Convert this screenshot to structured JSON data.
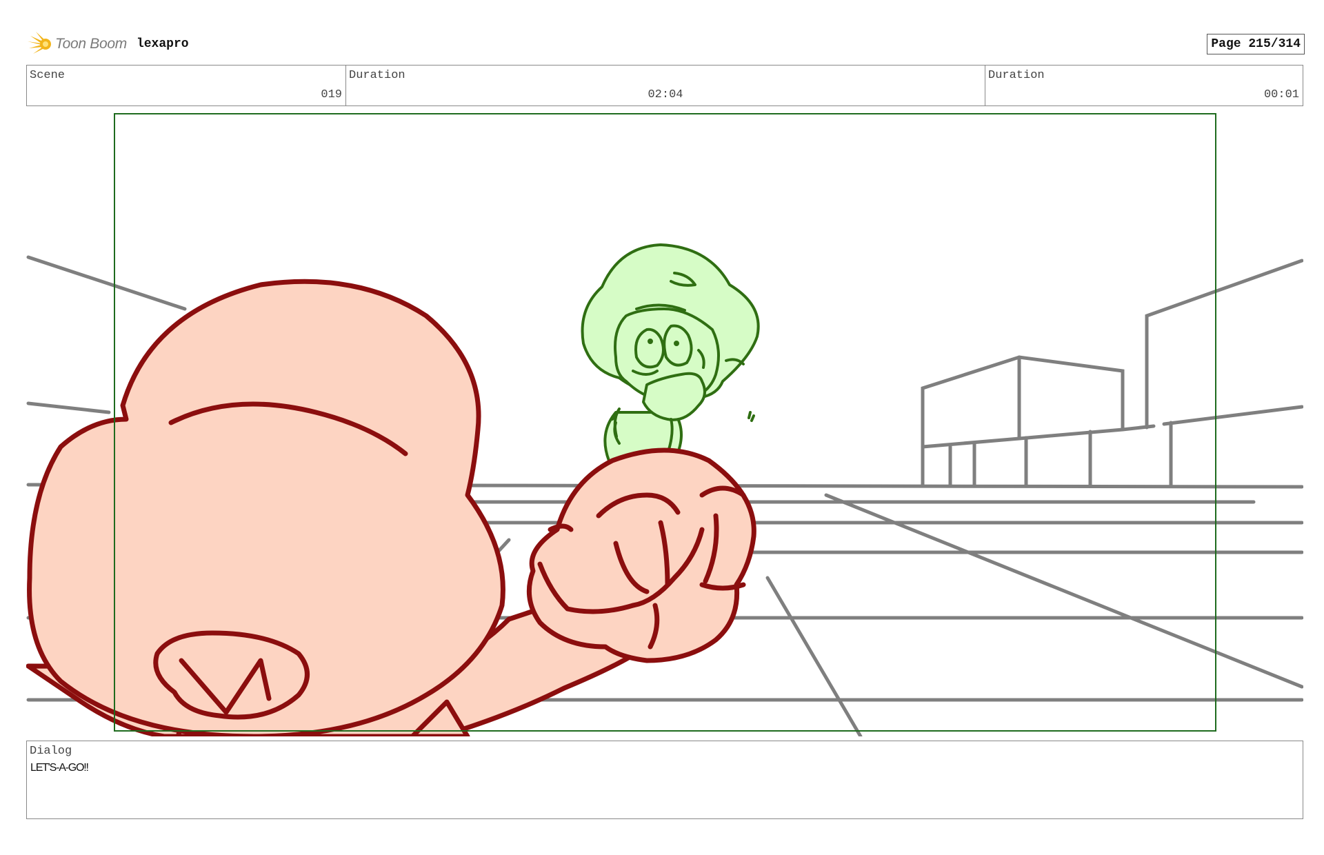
{
  "header": {
    "logo_text": "Toon Boom",
    "project_name": "lexapro",
    "page_label": "Page 215/314"
  },
  "fields": [
    {
      "label": "Scene",
      "value": "019"
    },
    {
      "label": "Duration",
      "value": "02:04"
    },
    {
      "label": "Duration",
      "value": "00:01"
    }
  ],
  "dialog": {
    "label": "Dialog",
    "text": "LET'S-A-GO!!"
  },
  "colors": {
    "frame_border": "#1e6b1e",
    "red_character_outline": "#8b0e0e",
    "red_character_fill": "#fdd4c2",
    "green_character_outline": "#2f6e12",
    "green_character_fill": "#d6fcc6",
    "background_lines": "#7f7f7f",
    "logo_accent": "#f2b51c"
  },
  "icons": {
    "logo": "toon-boom-starburst-icon"
  }
}
